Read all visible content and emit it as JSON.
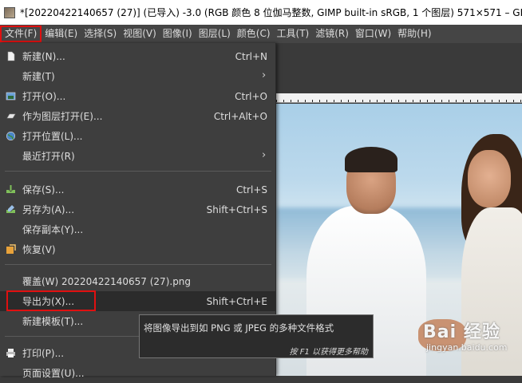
{
  "window": {
    "title": "*[20220422140657 (27)] (已导入) -3.0 (RGB 颜色 8 位伽马整数, GIMP built-in sRGB, 1 个图层) 571×571 – GIMP"
  },
  "menubar": {
    "items": [
      {
        "label": "文件(F)",
        "active": true
      },
      {
        "label": "编辑(E)"
      },
      {
        "label": "选择(S)"
      },
      {
        "label": "视图(V)"
      },
      {
        "label": "图像(I)"
      },
      {
        "label": "图层(L)"
      },
      {
        "label": "颜色(C)"
      },
      {
        "label": "工具(T)"
      },
      {
        "label": "滤镜(R)"
      },
      {
        "label": "窗口(W)"
      },
      {
        "label": "帮助(H)"
      }
    ]
  },
  "file_menu": {
    "items": [
      {
        "label": "新建(N)...",
        "shortcut": "Ctrl+N",
        "icon": "new-document-icon"
      },
      {
        "label": "新建(T)",
        "submenu": true
      },
      {
        "label": "打开(O)...",
        "shortcut": "Ctrl+O",
        "icon": "open-image-icon"
      },
      {
        "label": "作为图层打开(E)...",
        "shortcut": "Ctrl+Alt+O",
        "icon": "open-as-layer-icon"
      },
      {
        "label": "打开位置(L)...",
        "icon": "open-location-icon"
      },
      {
        "label": "最近打开(R)",
        "submenu": true
      },
      {
        "label": "保存(S)...",
        "shortcut": "Ctrl+S",
        "icon": "save-icon"
      },
      {
        "label": "另存为(A)...",
        "shortcut": "Shift+Ctrl+S",
        "icon": "save-as-icon"
      },
      {
        "label": "保存副本(Y)..."
      },
      {
        "label": "恢复(V)",
        "icon": "revert-icon"
      },
      {
        "label": "覆盖(W) 20220422140657 (27).png"
      },
      {
        "label": "导出为(X)...",
        "shortcut": "Shift+Ctrl+E",
        "highlighted": true
      },
      {
        "label": "新建模板(T)..."
      },
      {
        "label": "打印(P)...",
        "icon": "print-icon"
      },
      {
        "label": "页面设置(U)..."
      }
    ]
  },
  "tooltip": {
    "text": "将图像导出到如 PNG 或 JPEG 的多种文件格式",
    "hint": "按 F1 以获得更多帮助"
  },
  "watermark": {
    "main": "Bai 经验",
    "sub": "jingyan.baidu.com"
  },
  "colors": {
    "menu_bg": "#3e3e3e",
    "menubar_bg": "#454545",
    "highlight_box": "#e01010",
    "tooltip_bg": "#2c2c2c"
  }
}
